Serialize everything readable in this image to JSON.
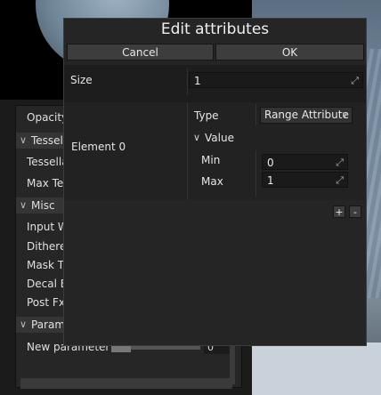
{
  "background": {
    "properties": [
      {
        "label": "Opacity"
      },
      {
        "section": "Tessella"
      },
      {
        "label": "Tessella"
      },
      {
        "label": "Max Tes"
      },
      {
        "section": "Misc"
      },
      {
        "label": "Input W"
      },
      {
        "label": "Dithered"
      },
      {
        "label": "Mask Th"
      },
      {
        "label": "Decal Bl"
      },
      {
        "label": "Post Fx"
      },
      {
        "section": "Parame"
      },
      {
        "label": "New parameter"
      }
    ],
    "new_parameter_value": "0"
  },
  "dialog": {
    "title": "Edit attributes",
    "cancel_label": "Cancel",
    "ok_label": "OK",
    "size_label": "Size",
    "size_value": "1",
    "element_label": "Element 0",
    "type_label": "Type",
    "type_value": "Range Attribute",
    "value_label": "Value",
    "min_label": "Min",
    "min_value": "0",
    "max_label": "Max",
    "max_value": "1",
    "add_label": "+",
    "remove_label": "-"
  },
  "icons": {
    "resize": "⤢",
    "chevron_down": "⌵"
  }
}
